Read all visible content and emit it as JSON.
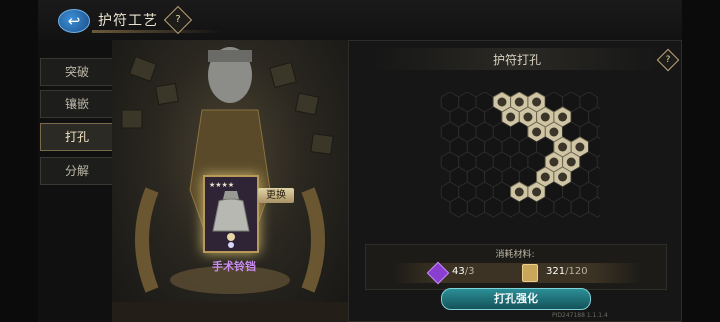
{
  "header": {
    "title": "护符工艺",
    "back_icon": "back-arrow-icon",
    "help_icon": "help-diamond-icon"
  },
  "tabs": [
    {
      "label": "突破",
      "active": false
    },
    {
      "label": "镶嵌",
      "active": false
    },
    {
      "label": "打孔",
      "active": true
    },
    {
      "label": "分解",
      "active": false
    }
  ],
  "item": {
    "name": "手术铃铛",
    "swap_label": "更换",
    "name_color": "#c98cf0"
  },
  "panel": {
    "title": "护符打孔",
    "cost_label": "消耗材料:",
    "costs": [
      {
        "icon": "purple-crystal-icon",
        "current": "43",
        "required": "/3"
      },
      {
        "icon": "scroll-icon",
        "current": "321",
        "required": "/120"
      }
    ],
    "action_label": "打孔强化",
    "version": "PID247188 1.1.1.4"
  },
  "colors": {
    "accent_gold": "#b79a58",
    "button_teal": "#2b8f97"
  }
}
